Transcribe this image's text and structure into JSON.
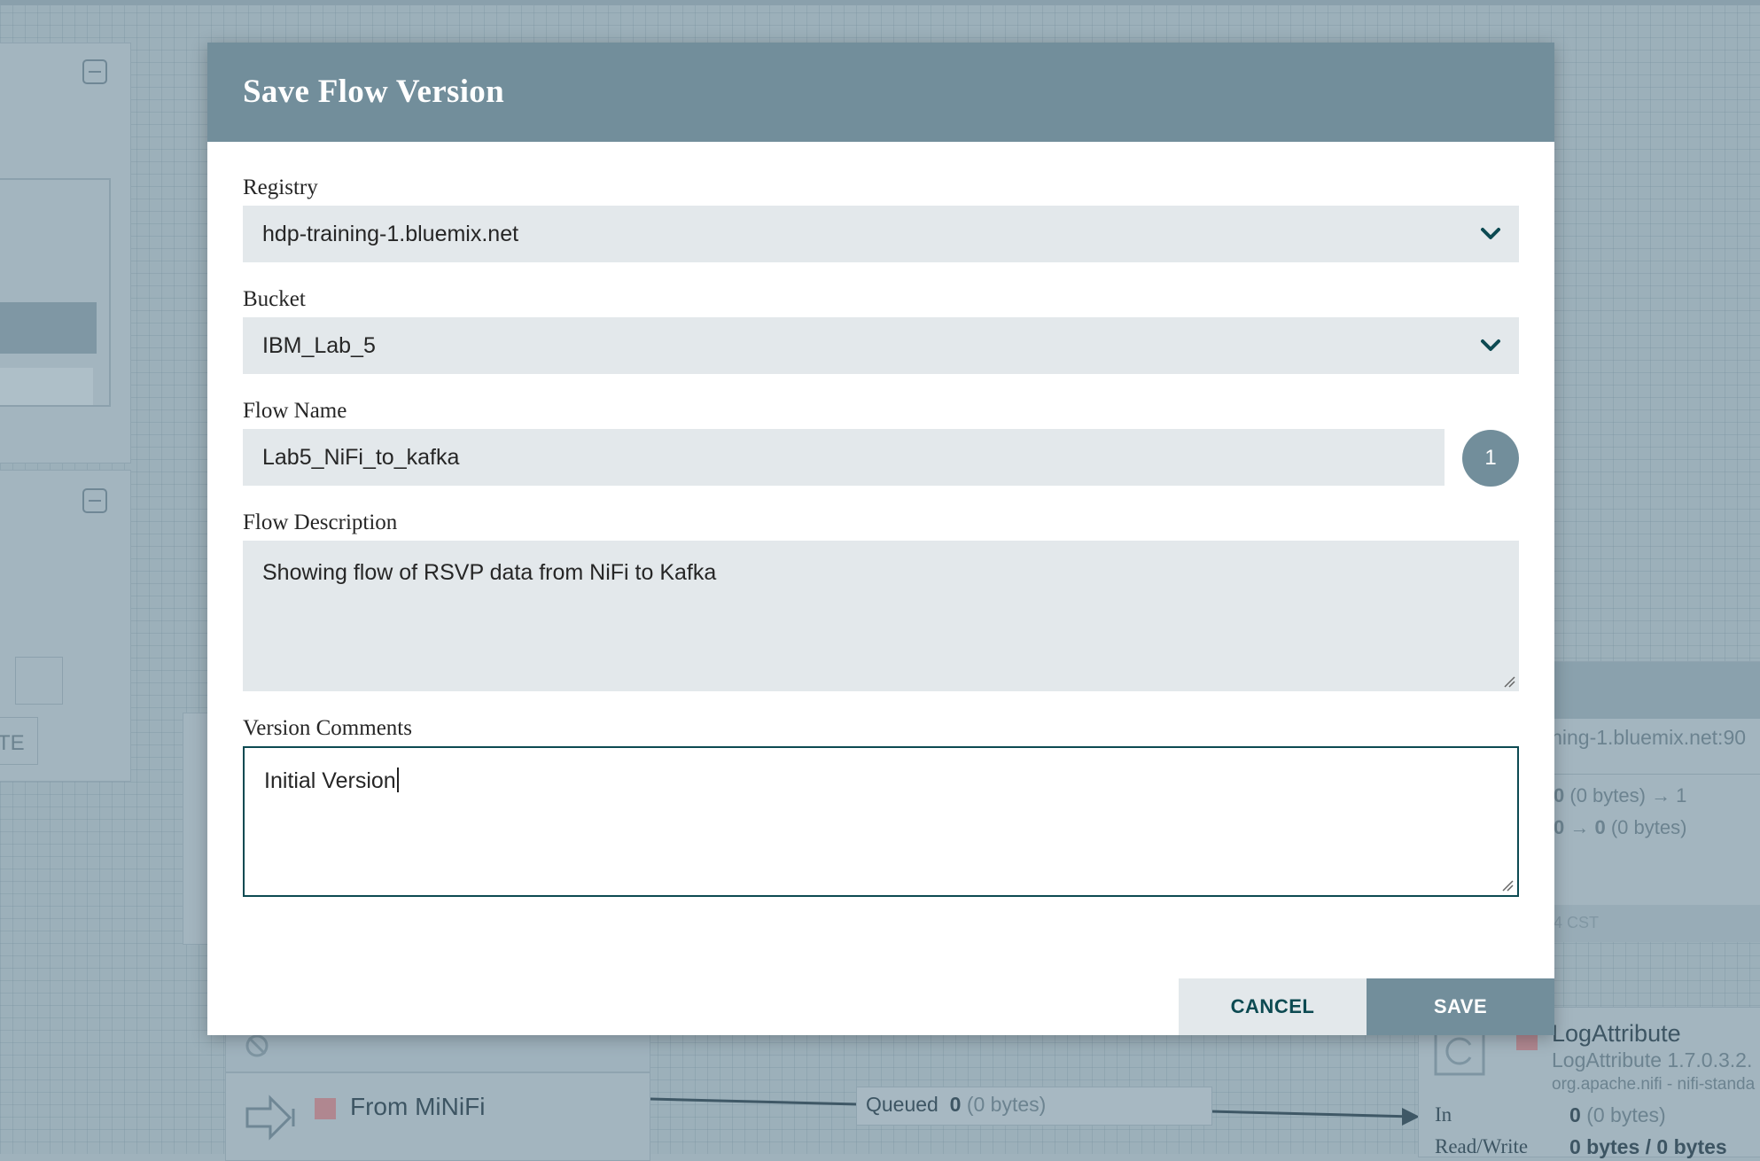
{
  "dialog": {
    "title": "Save Flow Version",
    "registry": {
      "label": "Registry",
      "value": "hdp-training-1.bluemix.net"
    },
    "bucket": {
      "label": "Bucket",
      "value": "IBM_Lab_5"
    },
    "flow_name": {
      "label": "Flow Name",
      "value": "Lab5_NiFi_to_kafka",
      "version": "1"
    },
    "flow_description": {
      "label": "Flow Description",
      "value": "Showing flow of RSVP data from NiFi to Kafka"
    },
    "version_comments": {
      "label": "Version Comments",
      "value": "Initial Version"
    },
    "cancel_label": "CANCEL",
    "save_label": "SAVE"
  },
  "background": {
    "left_text_fragment": "TE",
    "right_panel": {
      "url_fragment": "ining-1.bluemix.net:90",
      "stat1_bold": "0",
      "stat1_rest": "(0 bytes) → 1",
      "stat2_bold": "0 → 0",
      "stat2_rest": "(0 bytes)",
      "timestamp_fragment": "4 CST"
    },
    "input_port": {
      "name": "From MiNiFi"
    },
    "connection": {
      "queued_label": "Queued",
      "queued_value": "0",
      "queued_bytes": "(0 bytes)"
    },
    "processor": {
      "name": "LogAttribute",
      "type": "LogAttribute 1.7.0.3.2.",
      "bundle": "org.apache.nifi - nifi-standa",
      "in_label": "In",
      "in_value": "0",
      "in_bytes": "(0 bytes)",
      "rw_label": "Read/Write",
      "rw_value": "0 bytes / 0 bytes"
    }
  },
  "colors": {
    "header": "#728e9b",
    "field_bg": "#e3e8eb",
    "accent": "#0d4a52",
    "canvas": "#9cb0ba"
  }
}
